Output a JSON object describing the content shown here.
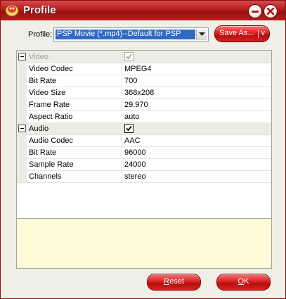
{
  "window": {
    "title": "Profile"
  },
  "profile": {
    "label": "Profile:",
    "selected": "PSP Movie (*.mp4)--Default for PSP",
    "save_as_label": "Save As...",
    "save_as_underline": "A"
  },
  "properties": [
    {
      "type": "category",
      "name": "Video",
      "checked": true,
      "disabled": true
    },
    {
      "type": "prop",
      "name": "Video Codec",
      "value": "MPEG4"
    },
    {
      "type": "prop",
      "name": "Bit Rate",
      "value": "700"
    },
    {
      "type": "prop",
      "name": "Video Size",
      "value": "368x208"
    },
    {
      "type": "prop",
      "name": "Frame Rate",
      "value": "29.970"
    },
    {
      "type": "prop",
      "name": "Aspect Ratio",
      "value": "auto"
    },
    {
      "type": "category",
      "name": "Audio",
      "checked": true,
      "disabled": false
    },
    {
      "type": "prop",
      "name": "Audio Codec",
      "value": "AAC"
    },
    {
      "type": "prop",
      "name": "Bit Rate",
      "value": "96000"
    },
    {
      "type": "prop",
      "name": "Sample Rate",
      "value": "24000"
    },
    {
      "type": "prop",
      "name": "Channels",
      "value": "stereo"
    }
  ],
  "buttons": {
    "reset": "Reset",
    "ok": "OK"
  },
  "colors": {
    "title_red": "#b41d1d",
    "button_red": "#df2a2a",
    "selection": "#316ac5",
    "description_bg": "#fffdd9"
  }
}
